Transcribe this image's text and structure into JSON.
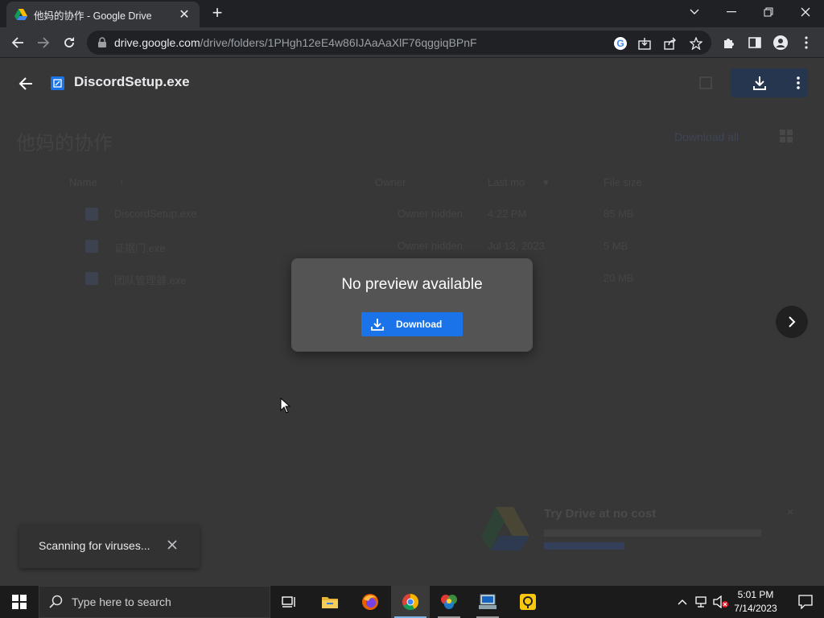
{
  "browser": {
    "tab_title": "他妈的协作 - Google Drive",
    "tab_close": "✕",
    "new_tab": "+",
    "url_host": "drive.google.com",
    "url_path": "/drive/folders/1PHgh12eE4w86IJAaAaXlF76qggiqBPnF",
    "accent": "#1a73e8"
  },
  "drive": {
    "folder_title": "他妈的协作",
    "download_all": "Download all",
    "columns": {
      "name": "Name",
      "sort_arrow": "↑",
      "owner": "Owner",
      "last_modified": "Last mo",
      "last_modified_arrow": "▾",
      "file_size": "File size"
    },
    "files": [
      {
        "name": "DiscordSetup.exe",
        "owner": "Owner hidden",
        "date": "4:22 PM",
        "size": "85 MB"
      },
      {
        "name": "证据门.exe",
        "owner": "Owner hidden",
        "date": "Jul 13, 2023",
        "size": "5 MB"
      },
      {
        "name": "团队管理器.exe",
        "owner": "",
        "date": "",
        "size": "20 MB"
      }
    ],
    "promo": {
      "title": "Try Drive at no cost",
      "close": "×"
    }
  },
  "viewer": {
    "file_name": "DiscordSetup.exe",
    "no_preview": "No preview available",
    "download_label": "Download"
  },
  "toast": {
    "message": "Scanning for viruses..."
  },
  "taskbar": {
    "search_placeholder": "Type here to search",
    "time": "5:01 PM",
    "date": "7/14/2023"
  }
}
